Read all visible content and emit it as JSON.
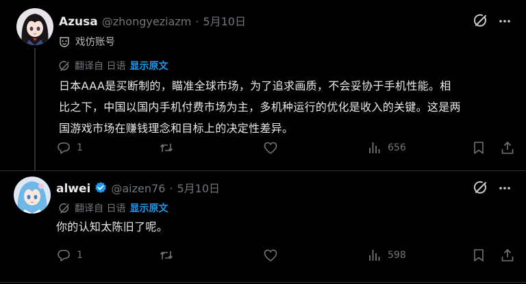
{
  "colors": {
    "background": "#000000",
    "text": "#e7e9ea",
    "muted": "#71767b",
    "accent": "#1d9bf0",
    "divider": "#2f3336"
  },
  "tweets": [
    {
      "author_name": "Azusa",
      "handle": "@zhongyeziazm",
      "separator": "·",
      "date": "5月10日",
      "verified": false,
      "avatar_icon": "anime-girl-black-hair-avatar",
      "parody_label": "戏仿账号",
      "translate": {
        "label": "翻译自 日语",
        "show_original": "显示原文"
      },
      "text_lines": [
        "日本AAA是买断制的，瞄准全球市场，为了追求画质，不会妥协于手机性能。相",
        "比之下，中国以国内手机付费市场为主，多机种运行的优化是收入的关键。这是两",
        "国游戏市场在赚钱理念和目标上的决定性差异。"
      ],
      "actions": {
        "replies": "1",
        "retweets": "",
        "likes": "",
        "views": "656"
      }
    },
    {
      "author_name": "alwei",
      "handle": "@aizen76",
      "separator": "·",
      "date": "5月10日",
      "verified": true,
      "avatar_icon": "anime-girl-blue-hair-avatar",
      "translate": {
        "label": "翻译自 日语",
        "show_original": "显示原文"
      },
      "text_lines": [
        "你的认知太陈旧了呢。"
      ],
      "actions": {
        "replies": "1",
        "retweets": "",
        "likes": "",
        "views": "598"
      }
    }
  ]
}
